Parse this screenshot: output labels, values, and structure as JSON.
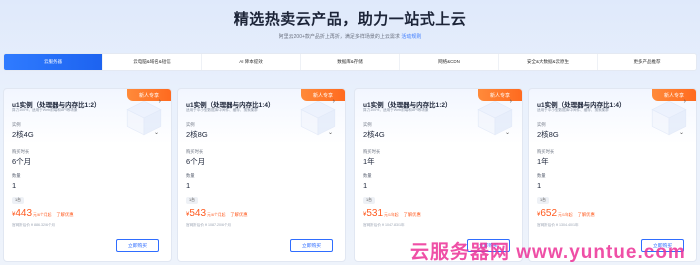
{
  "header": {
    "title": "精选热卖云产品，助力一站式上云",
    "subtitle_pre": "阿里云200+款产品折上再折，满足多样场景的上云需求",
    "subtitle_link": "活动规则"
  },
  "tabs": [
    {
      "label": "云服务器"
    },
    {
      "label": "云电脑&域名&短信"
    },
    {
      "label": "AI 降本提效"
    },
    {
      "label": "数据库&存储"
    },
    {
      "label": "网络&CDN"
    },
    {
      "label": "安全&大数据&云原生"
    },
    {
      "label": "更多产品推荐"
    }
  ],
  "cards": [
    {
      "badge": "新人专享",
      "title": "u1实例（处理器与内存比1:2）",
      "desc": "算力100%，适用于Web前端和API等场景",
      "spec_label": "实例",
      "spec_value": "2核4G",
      "duration_label": "购买时长",
      "duration_value": "6个月",
      "qty_label": "数量",
      "qty_value": "1",
      "tag": "1台",
      "price": "443",
      "price_unit": "元/6个月起",
      "price_link": "了解优惠",
      "original": "官网折后价 ¥ 886.32/6个月",
      "button": "立即购买"
    },
    {
      "badge": "新人专享",
      "title": "u1实例（处理器与内存比1:4）",
      "desc": "适用于中小型数据库中间件、缓存、搜索集群",
      "spec_label": "实例",
      "spec_value": "2核8G",
      "duration_label": "购买时长",
      "duration_value": "6个月",
      "qty_label": "数量",
      "qty_value": "1",
      "tag": "1台",
      "price": "543",
      "price_unit": "元/6个月起",
      "price_link": "了解优惠",
      "original": "官网折后价 ¥ 1087.20/6个月",
      "button": "立即购买"
    },
    {
      "badge": "新人专享",
      "title": "u1实例（处理器与内存比1:2）",
      "desc": "算力100%，适用于Web前端和API等场景",
      "spec_label": "实例",
      "spec_value": "2核4G",
      "duration_label": "购买时长",
      "duration_value": "1年",
      "qty_label": "数量",
      "qty_value": "1",
      "tag": "1台",
      "price": "531",
      "price_unit": "元/1年起",
      "price_link": "了解优惠",
      "original": "官网折后价 ¥ 1047.83/1年",
      "button": "立即购买"
    },
    {
      "badge": "新人专享",
      "title": "u1实例（处理器与内存比1:4）",
      "desc": "适用于中小型数据库中间件、缓存、搜索集群",
      "spec_label": "实例",
      "spec_value": "2核8G",
      "duration_label": "购买时长",
      "duration_value": "1年",
      "qty_label": "数量",
      "qty_value": "1",
      "tag": "1台",
      "price": "652",
      "price_unit": "元/1年起",
      "price_link": "了解优惠",
      "original": "官网折后价 ¥ 1304.40/1年",
      "button": "立即购买"
    }
  ],
  "currency_symbol": "¥",
  "watermark": "云服务器网 www.yuntue.com"
}
